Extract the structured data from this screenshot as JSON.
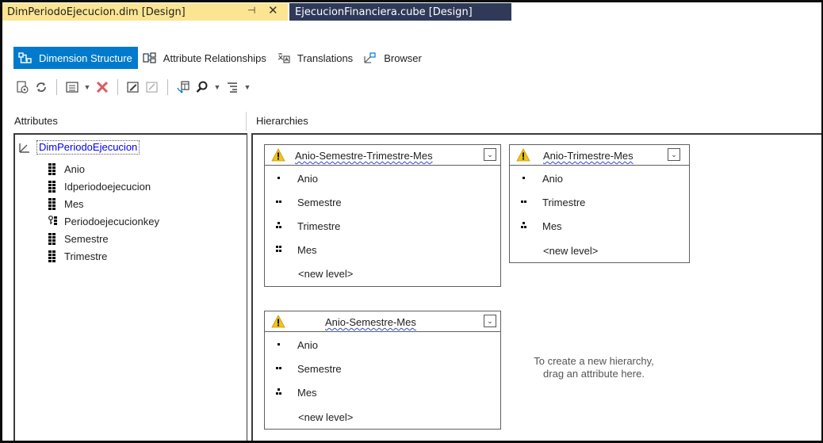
{
  "tabs": {
    "active_label": "DimPeriodoEjecucion.dim [Design]",
    "pin_glyph": "⊣",
    "close_glyph": "✕",
    "inactive_label": "EjecucionFinanciera.cube [Design]"
  },
  "designer_tabs": {
    "dimension_structure": "Dimension Structure",
    "attribute_relationships": "Attribute Relationships",
    "translations": "Translations",
    "browser": "Browser"
  },
  "panes": {
    "attributes_header": "Attributes",
    "hierarchies_header": "Hierarchies"
  },
  "dimension": {
    "name": "DimPeriodoEjecucion",
    "attributes": [
      "Anio",
      "Idperiodoejecucion",
      "Mes",
      "Periodoejecucionkey",
      "Semestre",
      "Trimestre"
    ]
  },
  "hierarchies": [
    {
      "name": "Anio-Semestre-Trimestre-Mes",
      "levels": [
        "Anio",
        "Semestre",
        "Trimestre",
        "Mes"
      ],
      "new_level": "<new level>"
    },
    {
      "name": "Anio-Trimestre-Mes",
      "levels": [
        "Anio",
        "Trimestre",
        "Mes"
      ],
      "new_level": "<new level>"
    },
    {
      "name": "Anio-Semestre-Mes",
      "levels": [
        "Anio",
        "Semestre",
        "Mes"
      ],
      "new_level": "<new level>"
    }
  ],
  "hint": {
    "line1": "To create a new hierarchy,",
    "line2": "drag an attribute here."
  },
  "colors": {
    "active_tab": "#fbe592",
    "inactive_tab": "#2f3a59",
    "designer_tab_active": "#007acc",
    "warning": "#f0c419"
  }
}
